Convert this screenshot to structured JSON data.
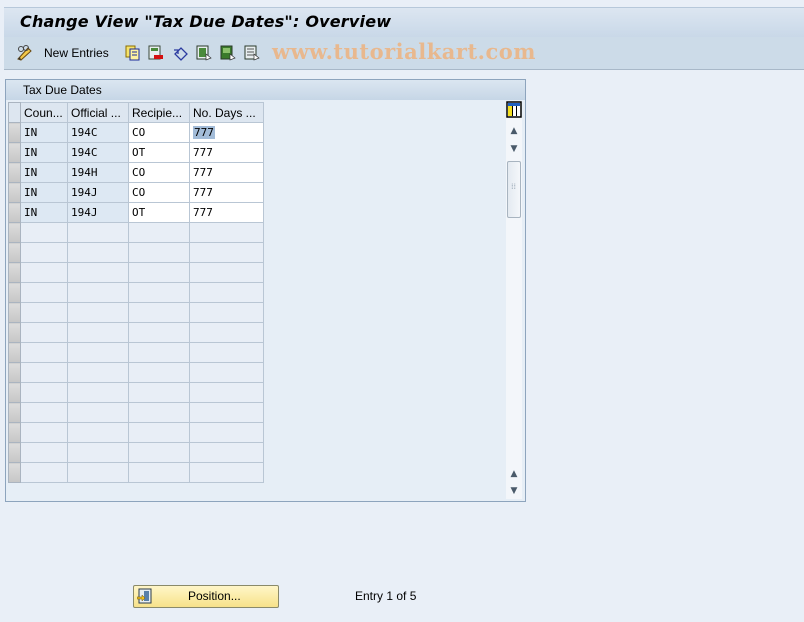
{
  "window": {
    "title": "Change View \"Tax Due Dates\": Overview"
  },
  "toolbar": {
    "items": [
      {
        "icon": "change-display-icon"
      },
      {
        "label": "New Entries"
      },
      {
        "icon": "copy-icon"
      },
      {
        "icon": "delete-icon"
      },
      {
        "icon": "undo-change-icon"
      },
      {
        "icon": "select-all-icon"
      },
      {
        "icon": "select-block-icon"
      },
      {
        "icon": "deselect-all-icon"
      }
    ],
    "new_entries_label": "New Entries",
    "watermark": "www.tutorialkart.com"
  },
  "panel": {
    "title": "Tax Due Dates",
    "columns": [
      "Coun...",
      "Official ...",
      "Recipie...",
      "No. Days ..."
    ],
    "rows": [
      [
        "IN",
        "194C",
        "CO",
        "777"
      ],
      [
        "IN",
        "194C",
        "OT",
        "777"
      ],
      [
        "IN",
        "194H",
        "CO",
        "777"
      ],
      [
        "IN",
        "194J",
        "CO",
        "777"
      ],
      [
        "IN",
        "194J",
        "OT",
        "777"
      ]
    ],
    "empty_rows": 13
  },
  "footer": {
    "position_button": "Position...",
    "entry_status": "Entry 1 of 5"
  }
}
